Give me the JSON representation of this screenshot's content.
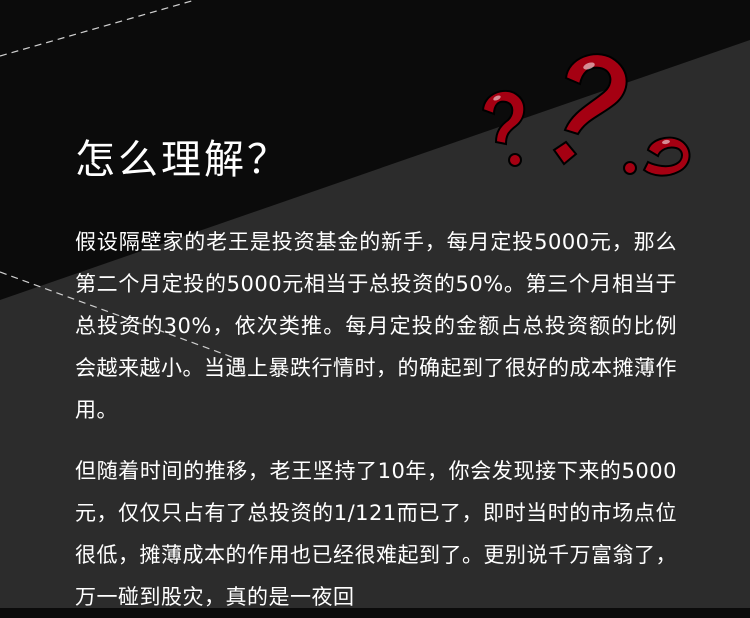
{
  "heading": "怎么理解？",
  "paragraphs": [
    "假设隔壁家的老王是投资基金的新手，每月定投5000元，那么第二个月定投的5000元相当于总投资的50%。第三个月相当于总投资的30%，依次类推。每月定投的金额占总投资额的比例会越来越小。当遇上暴跌行情时，的确起到了很好的成本摊薄作用。",
    "但随着时间的推移，老王坚持了10年，你会发现接下来的5000元，仅仅只占有了总投资的1/121而已了，即时当时的市场点位很低，摊薄成本的作用也已经很难起到了。更别说千万富翁了，万一碰到股灾，真的是一夜回"
  ],
  "colors": {
    "background_dark": "#0b0b0b",
    "background_gray": "#2c2c2c",
    "text": "#ffffff",
    "question_marks": "#a50012"
  },
  "decoration": {
    "question_marks_icon": "red-question-marks-icon",
    "dashed_lines_icon": "dashed-line-icon"
  }
}
